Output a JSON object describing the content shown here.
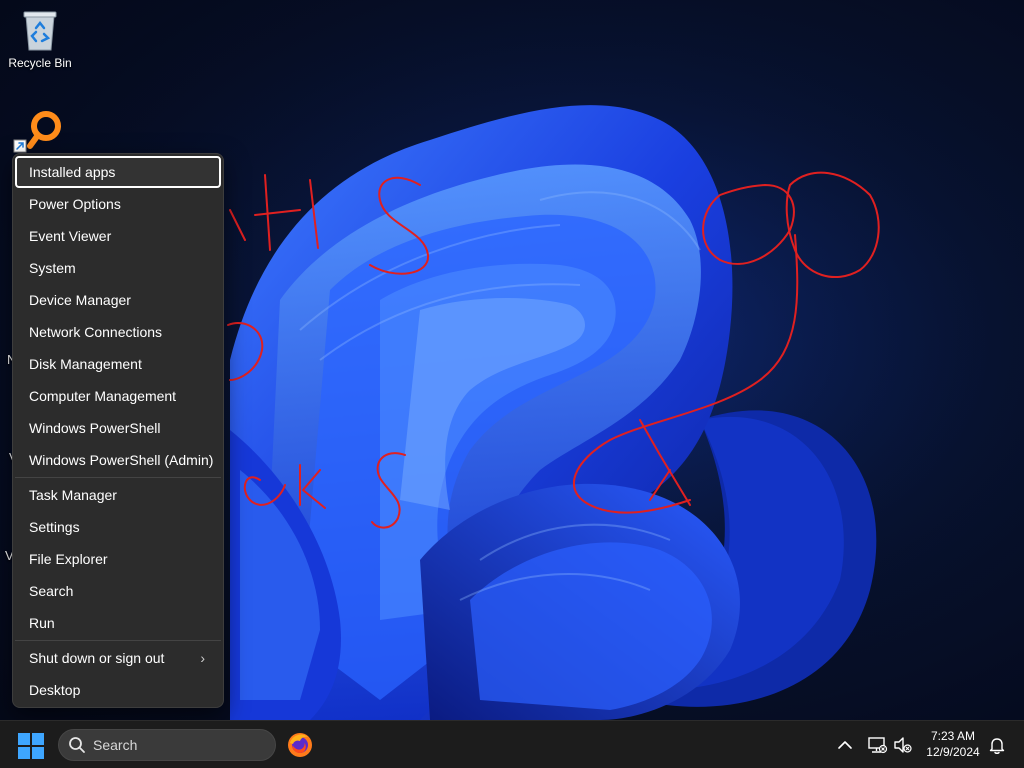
{
  "desktop": {
    "icons": [
      {
        "label": "Recycle Bin",
        "icon": "recycle-bin-icon"
      },
      {
        "label": "",
        "icon": "search-tool-shortcut-icon"
      }
    ],
    "edge_letters": [
      "N",
      "V",
      "V"
    ]
  },
  "context_menu": {
    "groups": [
      [
        "Installed apps",
        "Power Options",
        "Event Viewer",
        "System",
        "Device Manager",
        "Network Connections",
        "Disk Management",
        "Computer Management",
        "Windows PowerShell",
        "Windows PowerShell (Admin)"
      ],
      [
        "Task Manager",
        "Settings",
        "File Explorer",
        "Search",
        "Run"
      ],
      [
        "Shut down or sign out",
        "Desktop"
      ]
    ],
    "focused_item": "Installed apps",
    "submenu_chevron": "›"
  },
  "taskbar": {
    "start_icon": "windows-logo-icon",
    "search_placeholder": "Search",
    "pinned": [
      {
        "icon": "firefox-icon"
      }
    ],
    "tray": {
      "icons": [
        "chevron-up-icon",
        "network-icon",
        "volume-muted-icon",
        "notification-bell-icon"
      ],
      "time": "7:23 AM",
      "date": "12/9/2024"
    }
  },
  "colors": {
    "accent_blue": "#1f4bff",
    "annotation_red": "#e02020",
    "menu_bg": "#2c2c2c",
    "taskbar_bg": "#1c1c1c"
  }
}
